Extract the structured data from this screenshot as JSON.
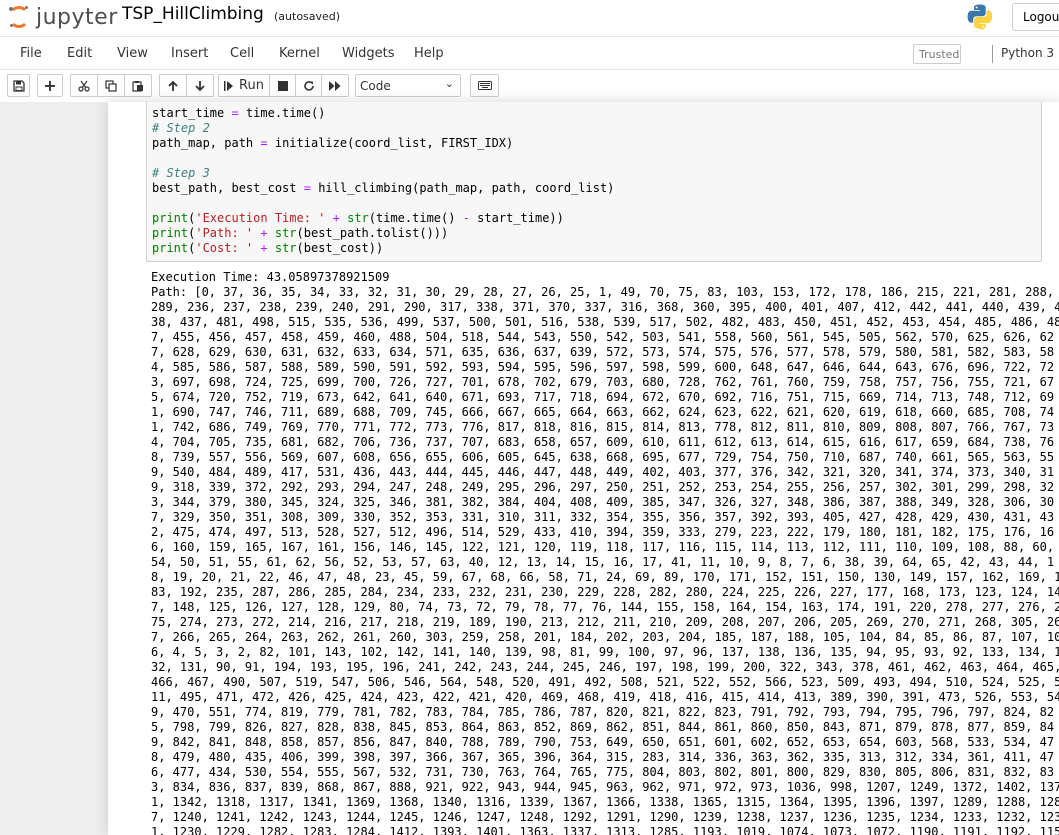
{
  "header": {
    "logo_text": "jupyter",
    "notebook_name": "TSP_HillClimbing",
    "autosave": "(autosaved)",
    "logout_label": "Logout"
  },
  "menubar": {
    "items": [
      "File",
      "Edit",
      "View",
      "Insert",
      "Cell",
      "Kernel",
      "Widgets",
      "Help"
    ],
    "trusted": "Trusted",
    "kernel": "Python 3"
  },
  "toolbar": {
    "run_label": "Run",
    "cell_type": "Code"
  },
  "cell": {
    "code_lines": [
      "start_time = time.time()",
      "# Step 2",
      "path_map, path = initialize(coord_list, FIRST_IDX)",
      "",
      "# Step 3",
      "best_path, best_cost = hill_climbing(path_map, path, coord_list)",
      "",
      "print('Execution Time: ' + str(time.time() - start_time))",
      "print('Path: ' + str(best_path.tolist()))",
      "print('Cost: ' + str(best_cost))"
    ],
    "output_lines": [
      "Execution Time: 43.05897378921509",
      "Path: [0, 37, 36, 35, 34, 33, 32, 31, 30, 29, 28, 27, 26, 25, 1, 49, 70, 75, 83, 103, 153, 172, 178, 186, 215, 221, 281, 288,",
      "289, 236, 237, 238, 239, 240, 291, 290, 317, 338, 371, 370, 337, 316, 368, 360, 395, 400, 401, 407, 412, 442, 441, 440, 439, 4",
      "38, 437, 481, 498, 515, 535, 536, 499, 537, 500, 501, 516, 538, 539, 517, 502, 482, 483, 450, 451, 452, 453, 454, 485, 486, 48",
      "7, 455, 456, 457, 458, 459, 460, 488, 504, 518, 544, 543, 550, 542, 503, 541, 558, 560, 561, 545, 505, 562, 570, 625, 626, 62",
      "7, 628, 629, 630, 631, 632, 633, 634, 571, 635, 636, 637, 639, 572, 573, 574, 575, 576, 577, 578, 579, 580, 581, 582, 583, 58",
      "4, 585, 586, 587, 588, 589, 590, 591, 592, 593, 594, 595, 596, 597, 598, 599, 600, 648, 647, 646, 644, 643, 676, 696, 722, 72",
      "3, 697, 698, 724, 725, 699, 700, 726, 727, 701, 678, 702, 679, 703, 680, 728, 762, 761, 760, 759, 758, 757, 756, 755, 721, 67",
      "5, 674, 720, 752, 719, 673, 642, 641, 640, 671, 693, 717, 718, 694, 672, 670, 692, 716, 751, 715, 669, 714, 713, 748, 712, 69",
      "1, 690, 747, 746, 711, 689, 688, 709, 745, 666, 667, 665, 664, 663, 662, 624, 623, 622, 621, 620, 619, 618, 660, 685, 708, 74",
      "1, 742, 686, 749, 769, 770, 771, 772, 773, 776, 817, 818, 816, 815, 814, 813, 778, 812, 811, 810, 809, 808, 807, 766, 767, 73",
      "4, 704, 705, 735, 681, 682, 706, 736, 737, 707, 683, 658, 657, 609, 610, 611, 612, 613, 614, 615, 616, 617, 659, 684, 738, 76",
      "8, 739, 557, 556, 569, 607, 608, 656, 655, 606, 605, 645, 638, 668, 695, 677, 729, 754, 750, 710, 687, 740, 661, 565, 563, 55",
      "9, 540, 484, 489, 417, 531, 436, 443, 444, 445, 446, 447, 448, 449, 402, 403, 377, 376, 342, 321, 320, 341, 374, 373, 340, 31",
      "9, 318, 339, 372, 292, 293, 294, 247, 248, 249, 295, 296, 297, 250, 251, 252, 253, 254, 255, 256, 257, 302, 301, 299, 298, 32",
      "3, 344, 379, 380, 345, 324, 325, 346, 381, 382, 384, 404, 408, 409, 385, 347, 326, 327, 348, 386, 387, 388, 349, 328, 306, 30",
      "7, 329, 350, 351, 308, 309, 330, 352, 353, 331, 310, 311, 332, 354, 355, 356, 357, 392, 393, 405, 427, 428, 429, 430, 431, 43",
      "2, 475, 474, 497, 513, 528, 527, 512, 496, 514, 529, 433, 410, 394, 359, 333, 279, 223, 222, 179, 180, 181, 182, 175, 176, 16",
      "6, 160, 159, 165, 167, 161, 156, 146, 145, 122, 121, 120, 119, 118, 117, 116, 115, 114, 113, 112, 111, 110, 109, 108, 88, 60,",
      "54, 50, 51, 55, 61, 62, 56, 52, 53, 57, 63, 40, 12, 13, 14, 15, 16, 17, 41, 11, 10, 9, 8, 7, 6, 38, 39, 64, 65, 42, 43, 44, 1",
      "8, 19, 20, 21, 22, 46, 47, 48, 23, 45, 59, 67, 68, 66, 58, 71, 24, 69, 89, 170, 171, 152, 151, 150, 130, 149, 157, 162, 169, 1",
      "83, 192, 235, 287, 286, 285, 284, 234, 233, 232, 231, 230, 229, 228, 282, 280, 224, 225, 226, 227, 177, 168, 173, 123, 124, 14",
      "7, 148, 125, 126, 127, 128, 129, 80, 74, 73, 72, 79, 78, 77, 76, 144, 155, 158, 164, 154, 163, 174, 191, 220, 278, 277, 276, 2",
      "75, 274, 273, 272, 214, 216, 217, 218, 219, 189, 190, 213, 212, 211, 210, 209, 208, 207, 206, 205, 269, 270, 271, 268, 305, 26",
      "7, 266, 265, 264, 263, 262, 261, 260, 303, 259, 258, 201, 184, 202, 203, 204, 185, 187, 188, 105, 104, 84, 85, 86, 87, 107, 10",
      "6, 4, 5, 3, 2, 82, 101, 143, 102, 142, 141, 140, 139, 98, 81, 99, 100, 97, 96, 137, 138, 136, 135, 94, 95, 93, 92, 133, 134, 1",
      "32, 131, 90, 91, 194, 193, 195, 196, 241, 242, 243, 244, 245, 246, 197, 198, 199, 200, 322, 343, 378, 461, 462, 463, 464, 465,",
      "466, 467, 490, 507, 519, 547, 506, 546, 564, 548, 520, 491, 492, 508, 521, 522, 552, 566, 523, 509, 493, 494, 510, 524, 525, 5",
      "11, 495, 471, 472, 426, 425, 424, 423, 422, 421, 420, 469, 468, 419, 418, 416, 415, 414, 413, 389, 390, 391, 473, 526, 553, 54",
      "9, 470, 551, 774, 819, 779, 781, 782, 783, 784, 785, 786, 787, 820, 821, 822, 823, 791, 792, 793, 794, 795, 796, 797, 824, 82",
      "5, 798, 799, 826, 827, 828, 838, 845, 853, 864, 863, 852, 869, 862, 851, 844, 861, 860, 850, 843, 871, 879, 878, 877, 859, 84",
      "9, 842, 841, 848, 858, 857, 856, 847, 840, 788, 789, 790, 753, 649, 650, 651, 601, 602, 652, 653, 654, 603, 568, 533, 534, 47",
      "8, 479, 480, 435, 406, 399, 398, 397, 366, 367, 365, 396, 364, 315, 283, 314, 336, 363, 362, 335, 313, 312, 334, 361, 411, 47",
      "6, 477, 434, 530, 554, 555, 567, 532, 731, 730, 763, 764, 765, 775, 804, 803, 802, 801, 800, 829, 830, 805, 806, 831, 832, 83",
      "3, 834, 836, 837, 839, 868, 867, 888, 921, 922, 943, 944, 945, 963, 962, 971, 972, 973, 1036, 998, 1207, 1249, 1372, 1402, 137",
      "1, 1342, 1318, 1317, 1341, 1369, 1368, 1340, 1316, 1339, 1367, 1366, 1338, 1365, 1315, 1364, 1395, 1396, 1397, 1289, 1288, 128",
      "7, 1240, 1241, 1242, 1243, 1244, 1245, 1246, 1247, 1248, 1292, 1291, 1290, 1239, 1238, 1237, 1236, 1235, 1234, 1233, 1232, 123",
      "1, 1230, 1229, 1282, 1283, 1284, 1412, 1393, 1401, 1363, 1337, 1313, 1285, 1193, 1019, 1074, 1073, 1072, 1190, 1191, 1192, 115"
    ]
  },
  "colors": {
    "logo_orange": "#f37726",
    "comment": "#408080",
    "string": "#ba2121",
    "builtin": "#008000",
    "operator": "#aa22ff",
    "input_bg": "#f7f7f7",
    "notebook_bg": "#eeeeee"
  },
  "icons": [
    "jupyter-logo-icon",
    "python-logo-icon",
    "save-icon",
    "plus-icon",
    "cut-icon",
    "copy-icon",
    "paste-icon",
    "arrow-up-icon",
    "arrow-down-icon",
    "run-icon",
    "stop-icon",
    "restart-icon",
    "fast-forward-icon",
    "keyboard-icon"
  ]
}
